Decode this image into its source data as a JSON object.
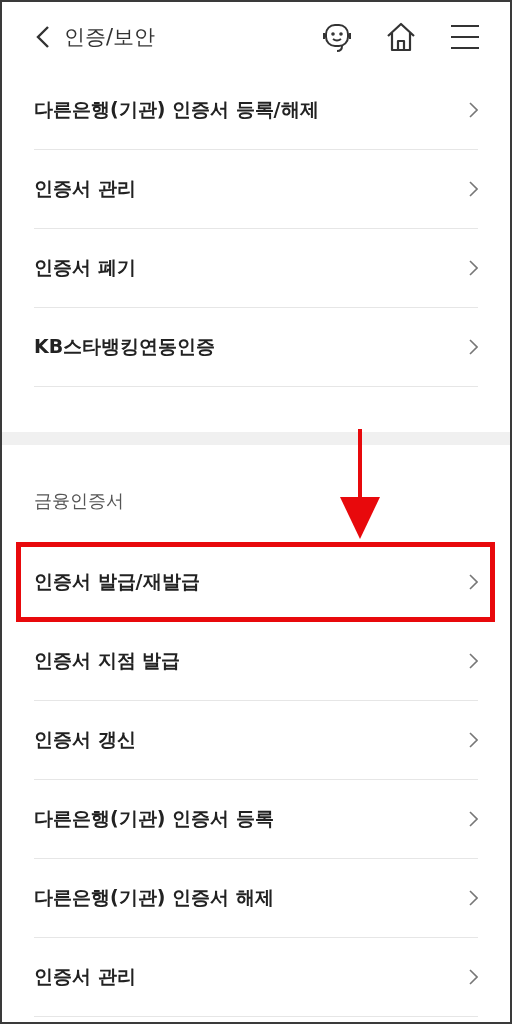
{
  "header": {
    "title": "인증/보안"
  },
  "sections": [
    {
      "items": [
        {
          "label": "다른은행(기관) 인증서 등록/해제",
          "highlighted": false
        },
        {
          "label": "인증서 관리",
          "highlighted": false
        },
        {
          "label": "인증서 폐기",
          "highlighted": false
        },
        {
          "label": "KB스타뱅킹연동인증",
          "highlighted": false
        }
      ]
    },
    {
      "label": "금융인증서",
      "items": [
        {
          "label": "인증서 발급/재발급",
          "highlighted": true
        },
        {
          "label": "인증서 지점 발급",
          "highlighted": false
        },
        {
          "label": "인증서 갱신",
          "highlighted": false
        },
        {
          "label": "다른은행(기관) 인증서 등록",
          "highlighted": false
        },
        {
          "label": "다른은행(기관) 인증서 해제",
          "highlighted": false
        },
        {
          "label": "인증서 관리",
          "highlighted": false
        }
      ]
    }
  ]
}
